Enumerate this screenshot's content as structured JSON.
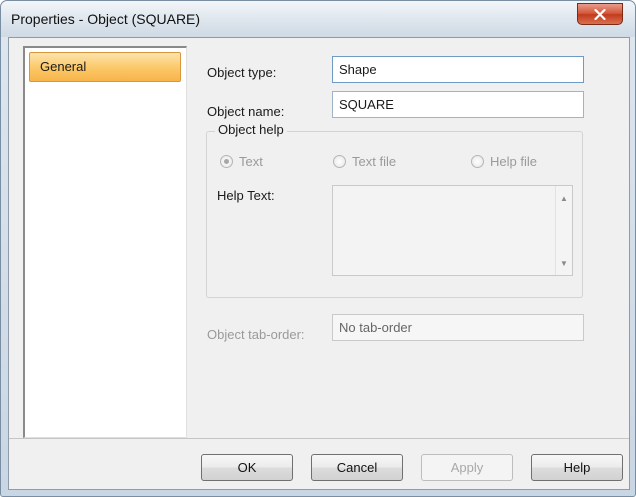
{
  "window": {
    "title": "Properties - Object (SQUARE)",
    "close_icon": "close-x-icon"
  },
  "sidebar": {
    "items": [
      {
        "label": "General",
        "selected": true
      }
    ]
  },
  "general": {
    "object_type_label": "Object type:",
    "object_type_value": "Shape",
    "object_name_label": "Object name:",
    "object_name_value": "SQUARE",
    "object_help": {
      "group_label": "Object help",
      "radio_text": "Text",
      "radio_text_file": "Text file",
      "radio_help_file": "Help file",
      "selected": "Text",
      "help_text_label": "Help Text:",
      "help_text_value": ""
    },
    "tab_order_label": "Object tab-order:",
    "tab_order_value": "No tab-order"
  },
  "buttons": {
    "ok": "OK",
    "cancel": "Cancel",
    "apply": "Apply",
    "help": "Help"
  },
  "colors": {
    "selected_item": "#fbca6b",
    "close_button": "#d3553a"
  }
}
